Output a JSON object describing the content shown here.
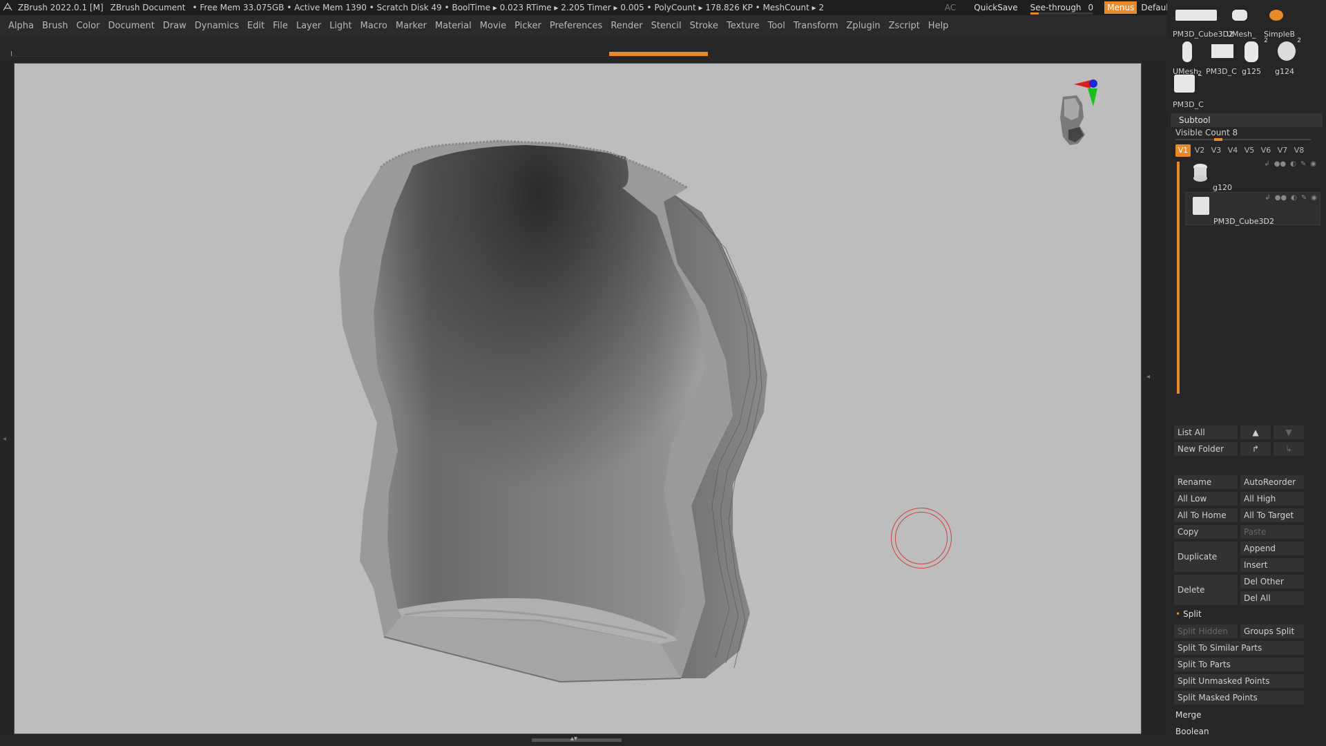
{
  "titlebar": {
    "app": "ZBrush 2022.0.1 [M]",
    "document": "ZBrush Document",
    "stats": "• Free Mem 33.075GB • Active Mem 1390 • Scratch Disk 49 •  BoolTime ▸ 0.023 RTime ▸ 2.205 Timer ▸ 0.005 • PolyCount ▸ 178.826 KP  • MeshCount ▸ 2",
    "ac": "AC",
    "quicksave": "QuickSave",
    "see_through_label": "See-through",
    "see_through_value": "0",
    "menus": "Menus",
    "script": "DefaultZScript"
  },
  "menu": [
    "Alpha",
    "Brush",
    "Color",
    "Document",
    "Draw",
    "Dynamics",
    "Edit",
    "File",
    "Layer",
    "Light",
    "Macro",
    "Marker",
    "Material",
    "Movie",
    "Picker",
    "Preferences",
    "Render",
    "Stencil",
    "Stroke",
    "Texture",
    "Tool",
    "Transform",
    "Zplugin",
    "Zscript",
    "Help"
  ],
  "tool_thumbs": [
    {
      "label": "PM3D_Cube3D2",
      "num": ""
    },
    {
      "label": "UMesh_",
      "num": ""
    },
    {
      "label": "SimpleB",
      "num": ""
    },
    {
      "label": "UMesh_",
      "num": ""
    },
    {
      "label": "PM3D_C",
      "num": ""
    },
    {
      "label": "g125",
      "num": "2"
    },
    {
      "label": "g124",
      "num": "2"
    },
    {
      "label": "PM3D_C",
      "num": "2"
    }
  ],
  "subtool": {
    "title": "Subtool",
    "visible_count": "Visible Count 8",
    "tabs": [
      "V1",
      "V2",
      "V3",
      "V4",
      "V5",
      "V6",
      "V7",
      "V8"
    ],
    "items": [
      {
        "name": "g120"
      },
      {
        "name": "PM3D_Cube3D2"
      }
    ],
    "list_all": "List All",
    "new_folder": "New Folder",
    "rename": "Rename",
    "autoreorder": "AutoReorder",
    "all_low": "All Low",
    "all_high": "All High",
    "all_to_home": "All To Home",
    "all_to_target": "All To Target",
    "copy": "Copy",
    "paste": "Paste",
    "duplicate": "Duplicate",
    "append": "Append",
    "insert": "Insert",
    "delete": "Delete",
    "del_other": "Del Other",
    "del_all": "Del All",
    "split": "Split",
    "split_hidden": "Split Hidden",
    "groups_split": "Groups Split",
    "split_similar": "Split To Similar Parts",
    "split_parts": "Split To Parts",
    "split_unmasked": "Split Unmasked Points",
    "split_masked": "Split Masked Points",
    "merge": "Merge",
    "boolean": "Boolean"
  }
}
